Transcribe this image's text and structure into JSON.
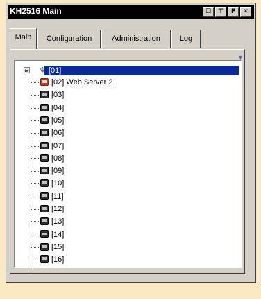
{
  "window": {
    "title": "KH2516 Main",
    "title_buttons": [
      "☐",
      "⊤",
      "F",
      "✕"
    ]
  },
  "tabs": [
    {
      "label": "Main",
      "active": true
    },
    {
      "label": "Configuration",
      "active": false
    },
    {
      "label": "Administration",
      "active": false
    },
    {
      "label": "Log",
      "active": false
    }
  ],
  "tree": {
    "root": {
      "label": "[01]",
      "expander": "⊟",
      "icon": "network-icon"
    },
    "items": [
      {
        "label": "[02] Web Server 2",
        "icon": "server-red-icon"
      },
      {
        "label": "[03]",
        "icon": "server-icon"
      },
      {
        "label": "[04]",
        "icon": "server-icon"
      },
      {
        "label": "[05]",
        "icon": "server-icon"
      },
      {
        "label": "[06]",
        "icon": "server-icon"
      },
      {
        "label": "[07]",
        "icon": "server-icon"
      },
      {
        "label": "[08]",
        "icon": "server-icon"
      },
      {
        "label": "[09]",
        "icon": "server-icon"
      },
      {
        "label": "[10]",
        "icon": "server-icon"
      },
      {
        "label": "[11]",
        "icon": "server-icon"
      },
      {
        "label": "[12]",
        "icon": "server-icon"
      },
      {
        "label": "[13]",
        "icon": "server-icon"
      },
      {
        "label": "[14]",
        "icon": "server-icon"
      },
      {
        "label": "[15]",
        "icon": "server-icon"
      },
      {
        "label": "[16]",
        "icon": "server-icon"
      }
    ]
  },
  "colors": {
    "background": "#fbe9c4",
    "selection": "#0a2a9c",
    "titlebar": "#000000"
  }
}
